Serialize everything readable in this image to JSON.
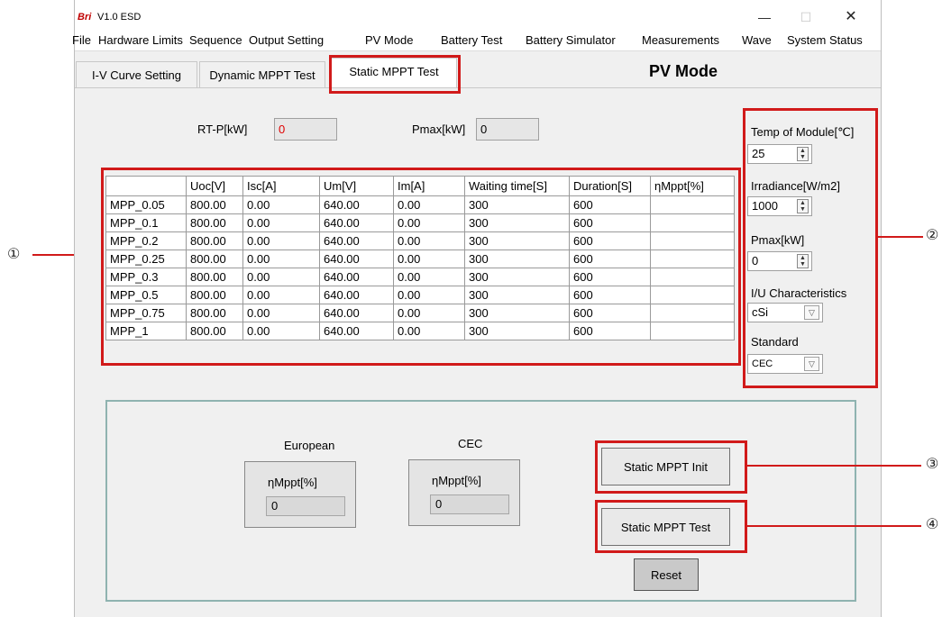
{
  "window": {
    "logo": "Bri",
    "title": "V1.0  ESD",
    "controls": {
      "minimize": "—",
      "maximize": "☐",
      "close": "✕"
    }
  },
  "menu": [
    "File",
    "Hardware Limits",
    "Sequence",
    "Output Setting",
    "PV Mode",
    "Battery Test",
    "Battery Simulator",
    "Measurements",
    "Wave",
    "System Status"
  ],
  "tabs": [
    "I-V Curve Setting",
    "Dynamic MPPT Test",
    "Static MPPT Test"
  ],
  "active_tab": "Static MPPT Test",
  "mode_title": "PV Mode",
  "readouts": {
    "rtp_label": "RT-P[kW]",
    "rtp_value": "0",
    "pmax_label": "Pmax[kW]",
    "pmax_value": "0"
  },
  "table": {
    "headers": [
      "",
      "Uoc[V]",
      "Isc[A]",
      "Um[V]",
      "Im[A]",
      "Waiting time[S]",
      "Duration[S]",
      "ηMppt[%]"
    ],
    "rows": [
      [
        "MPP_0.05",
        "800.00",
        "0.00",
        "640.00",
        "0.00",
        "300",
        "600",
        ""
      ],
      [
        "MPP_0.1",
        "800.00",
        "0.00",
        "640.00",
        "0.00",
        "300",
        "600",
        ""
      ],
      [
        "MPP_0.2",
        "800.00",
        "0.00",
        "640.00",
        "0.00",
        "300",
        "600",
        ""
      ],
      [
        "MPP_0.25",
        "800.00",
        "0.00",
        "640.00",
        "0.00",
        "300",
        "600",
        ""
      ],
      [
        "MPP_0.3",
        "800.00",
        "0.00",
        "640.00",
        "0.00",
        "300",
        "600",
        ""
      ],
      [
        "MPP_0.5",
        "800.00",
        "0.00",
        "640.00",
        "0.00",
        "300",
        "600",
        ""
      ],
      [
        "MPP_0.75",
        "800.00",
        "0.00",
        "640.00",
        "0.00",
        "300",
        "600",
        ""
      ],
      [
        "MPP_1",
        "800.00",
        "0.00",
        "640.00",
        "0.00",
        "300",
        "600",
        ""
      ]
    ]
  },
  "side_panel": {
    "temp_label": "Temp of Module[℃]",
    "temp_value": "25",
    "irradiance_label": "Irradiance[W/m2]",
    "irradiance_value": "1000",
    "pmax_label": "Pmax[kW]",
    "pmax_value": "0",
    "iu_label": "I/U Characteristics",
    "iu_value": "cSi",
    "standard_label": "Standard",
    "standard_value": "CEC"
  },
  "results": {
    "european_title": "European",
    "european_label": "ηMppt[%]",
    "european_value": "0",
    "cec_title": "CEC",
    "cec_label": "ηMppt[%]",
    "cec_value": "0"
  },
  "buttons": {
    "init": "Static MPPT Init",
    "test": "Static MPPT Test",
    "reset": "Reset"
  },
  "callouts": [
    "①",
    "②",
    "③",
    "④"
  ],
  "colors": {
    "highlight": "#d11a1a",
    "group_border": "#8fb3b0",
    "rtp_value": "#e00000"
  }
}
